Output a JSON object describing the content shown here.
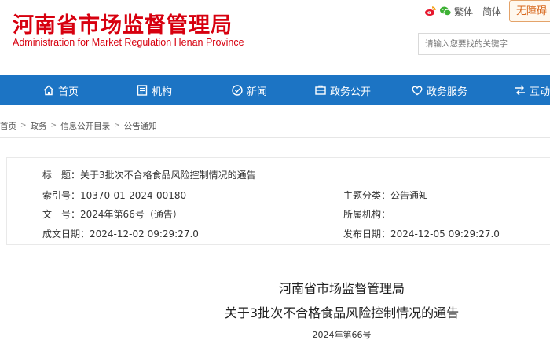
{
  "header": {
    "logo_cn": "河南省市场监督管理局",
    "logo_en": "Administration for Market Regulation Henan Province",
    "lang_traditional": "繁体",
    "lang_simplified": "简体",
    "barrier_free": "无障碍",
    "search_placeholder": "请输入您要找的关键字"
  },
  "nav": {
    "items": [
      {
        "label": "首页",
        "icon": "home-icon"
      },
      {
        "label": "机构",
        "icon": "organization-icon"
      },
      {
        "label": "新闻",
        "icon": "news-icon"
      },
      {
        "label": "政务公开",
        "icon": "government-affairs-icon"
      },
      {
        "label": "政务服务",
        "icon": "heart-service-icon"
      },
      {
        "label": "互动",
        "icon": "interaction-icon"
      }
    ]
  },
  "breadcrumb": [
    "首页",
    "政务",
    "信息公开目录",
    "公告通知"
  ],
  "info": {
    "title_label": "标　题：",
    "title_value": "关于3批次不合格食品风险控制情况的通告",
    "index_label": "索引号：",
    "index_value": "10370-01-2024-00180",
    "subject_label": "主题分类：",
    "subject_value": "公告通知",
    "docno_label": "文　号：",
    "docno_value": "2024年第66号（通告）",
    "agency_label": "所属机构：",
    "agency_value": "",
    "created_label": "成文日期：",
    "created_value": "2024-12-02 09:29:27.0",
    "published_label": "发布日期：",
    "published_value": "2024-12-05 09:29:27.0"
  },
  "article": {
    "title_line1": "河南省市场监督管理局",
    "title_line2": "关于3批次不合格食品风险控制情况的通告",
    "number": "2024年第66号"
  },
  "colors": {
    "brand_red": "#d7000f",
    "nav_blue": "#1c74c4",
    "barrier_orange": "#d7661a"
  }
}
